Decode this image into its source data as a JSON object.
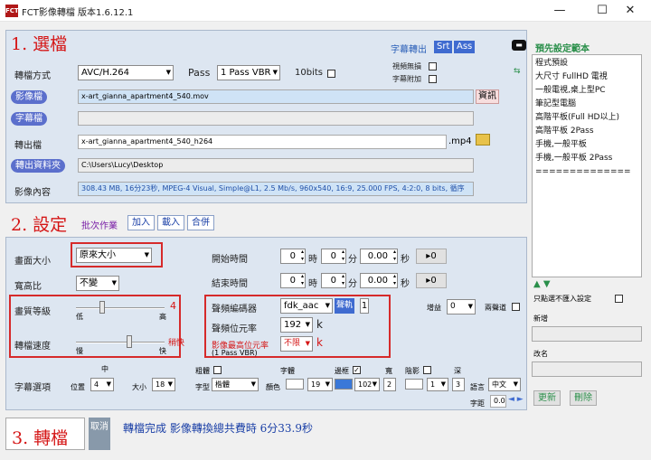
{
  "window": {
    "title": "FCT影像轉檔 版本1.6.12.1",
    "app_icon": "FCT",
    "minimize": "—",
    "maximize": "☐",
    "close": "✕"
  },
  "sec1": {
    "title": "1. 選檔",
    "subtitle_label": "字幕轉出",
    "srt": "Srt",
    "ass": "Ass",
    "format_label": "轉檔方式",
    "format_value": "AVC/H.264",
    "pass_label": "Pass",
    "pass_value": "1 Pass VBR",
    "bits_label": "10bits",
    "video_no_sub_label": "視頻無損",
    "sub_add_label": "字幕附加",
    "video_file_label": "影像檔",
    "video_file_value": "x-art_gianna_apartment4_540.mov",
    "info_btn": "資訊",
    "sub_file_label": "字幕檔",
    "sub_file_value": "",
    "output_file_label": "轉出檔",
    "output_file_value": "x-art_gianna_apartment4_540_h264",
    "ext": ".mp4",
    "output_folder_label": "轉出資料夾",
    "output_folder_value": "C:\\Users\\Lucy\\Desktop",
    "content_label": "影像內容",
    "content_value": "308.43 MB, 16分23秒, MPEG-4 Visual, Simple@L1, 2.5 Mb/s, 960x540, 16:9, 25.000 FPS, 4:2:0, 8 bits, 循序"
  },
  "sec2": {
    "title": "2. 設定",
    "batch_label": "批次作業",
    "add_btn": "加入",
    "load_btn": "載入",
    "merge_btn": "合併",
    "size_label": "畫面大小",
    "size_value": "原來大小",
    "aspect_label": "寬高比",
    "aspect_value": "不變",
    "start_label": "開始時間",
    "end_label": "結束時間",
    "hour": "時",
    "minute": "分",
    "second": "秒",
    "start": {
      "h": "0",
      "m": "0",
      "s": "0.00"
    },
    "end": {
      "h": "0",
      "m": "0",
      "s": "0.00"
    },
    "set_btn": "▸0",
    "quality_label": "畫質等級",
    "quality_low": "低",
    "quality_high": "高",
    "quality_value": "4",
    "quality_fraction": 0.3,
    "speed_label": "轉檔速度",
    "speed_slow": "慢",
    "speed_fast": "快",
    "speed_value": "稍快",
    "speed_fraction": 0.6,
    "audio_codec_label": "聲頻編碼器",
    "audio_codec_value": "fdk_aac",
    "channel_btn": "聲軌",
    "channel_value": "1",
    "audio_bitrate_label": "聲頻位元率",
    "audio_bitrate_value": "192",
    "audio_bitrate_unit": "k",
    "max_bitrate_label": "影像最高位元率",
    "max_bitrate_note": "(1 Pass VBR)",
    "max_bitrate_value": "不限",
    "max_bitrate_unit": "k",
    "gain_label": "增益",
    "gain_value": "0",
    "two_ch_label": "兩聲道"
  },
  "subtitle": {
    "label": "字幕選項",
    "middle": "中",
    "position_label": "位置",
    "position_value": "4",
    "size_label": "大小",
    "size_value": "18",
    "bold_label": "粗體",
    "font_label": "字型",
    "font_value": "楷體",
    "font_color_label": "字體",
    "color_label": "顏色",
    "color_value": "19",
    "border_label": "邊框",
    "border_value": "102",
    "width_label": "寬",
    "width_value": "2",
    "shadow_label": "陰影",
    "shadow_value": "1",
    "depth_label": "深",
    "depth_value": "3",
    "lang_label": "語言",
    "lang_value": "中文",
    "spacing_label": "字距",
    "spacing_value": "0.0",
    "border_color": "#3a78d8"
  },
  "sec3": {
    "title": "3. 轉檔",
    "cancel_btn": "取消",
    "status": "轉檔完成 影像轉換總共費時 6分33.9秒"
  },
  "presets": {
    "title": "預先設定範本",
    "items": [
      "程式預設",
      "大尺寸 FullHD 電視",
      "一般電視,桌上型PC",
      "筆記型電腦",
      "高階平板(Full HD以上)",
      "高階平板 2Pass",
      "手機,一般平板",
      "手機,一般平板  2Pass",
      "=============="
    ],
    "only_select_label": "只點選不匯入設定",
    "new_label": "新增",
    "rename_label": "改名",
    "update_btn": "更新",
    "delete_btn": "刪除",
    "arrows": "▲ ▼"
  },
  "colors": {
    "accent_red": "#d51616",
    "pill_blue": "#5b6fcc",
    "status_blue": "#1a3fa6",
    "panel": "#dde6f1"
  }
}
